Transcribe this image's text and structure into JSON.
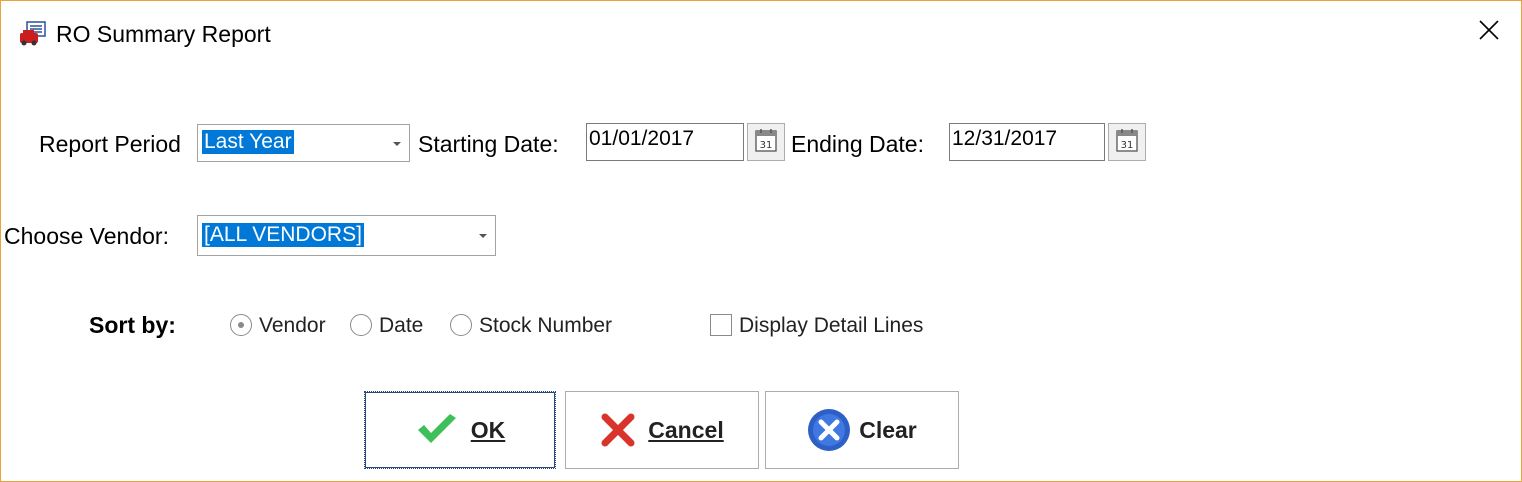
{
  "window": {
    "title": "RO Summary Report",
    "accent_color": "#e8a33d"
  },
  "filters": {
    "report_period_label": "Report Period",
    "report_period_value": "Last Year",
    "starting_date_label": "Starting Date:",
    "starting_date_value": "01/01/2017",
    "ending_date_label": "Ending Date:",
    "ending_date_value": "12/31/2017",
    "choose_vendor_label": "Choose Vendor:",
    "choose_vendor_value": "[ALL VENDORS]"
  },
  "sort": {
    "label": "Sort by:",
    "options": [
      {
        "label": "Vendor",
        "selected": true
      },
      {
        "label": "Date",
        "selected": false
      },
      {
        "label": "Stock Number",
        "selected": false
      }
    ],
    "display_detail_label": "Display Detail Lines",
    "display_detail_checked": false
  },
  "buttons": {
    "ok_label": "OK",
    "cancel_label": "Cancel",
    "clear_label": "Clear"
  },
  "icons": {
    "app": "report-icon",
    "close": "close-icon",
    "calendar": "calendar-icon",
    "ok": "checkmark-icon",
    "cancel": "red-x-icon",
    "clear": "blue-x-circle-icon"
  }
}
